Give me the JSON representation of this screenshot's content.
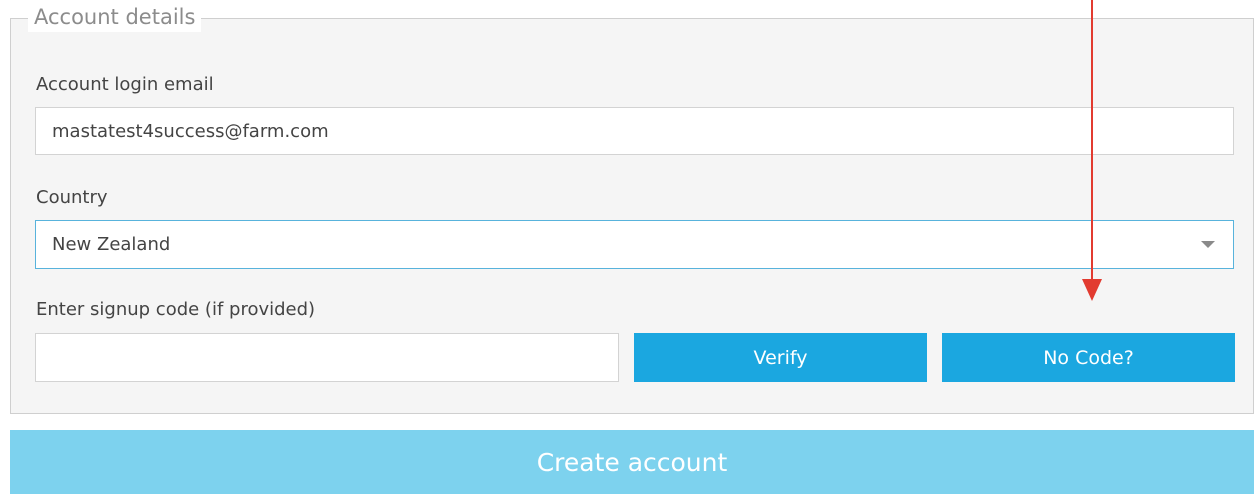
{
  "form": {
    "legend": "Account details",
    "email": {
      "label": "Account login email",
      "value": "mastatest4success@farm.com"
    },
    "country": {
      "label": "Country",
      "selected": "New Zealand"
    },
    "signup_code": {
      "label": "Enter signup code (if provided)",
      "value": "",
      "verify_label": "Verify",
      "no_code_label": "No Code?"
    },
    "create_label": "Create account"
  },
  "annotation": {
    "arrow_color": "#e23b30",
    "target": "No Code?"
  },
  "colors": {
    "primary_button": "#1ba7e0",
    "disabled_button": "#7dd2ee",
    "panel_background": "#f5f5f5"
  }
}
